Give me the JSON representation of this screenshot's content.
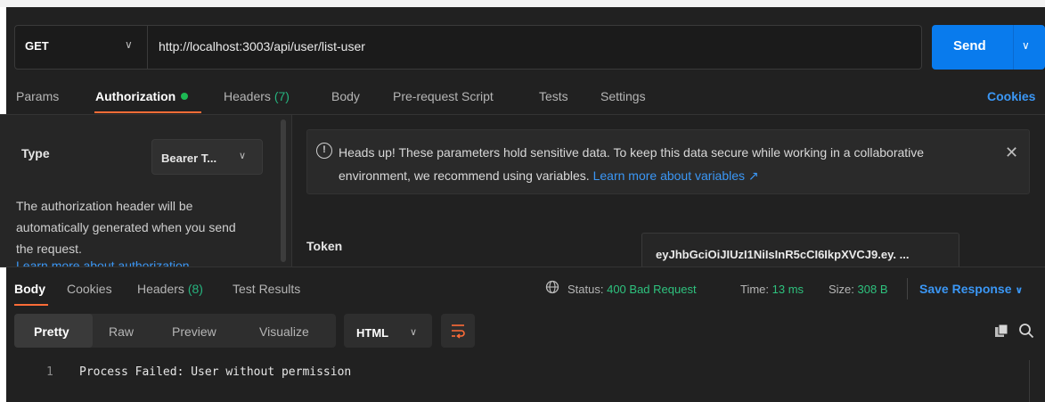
{
  "request": {
    "method": "GET",
    "url": "http://localhost:3003/api/user/list-user",
    "send_label": "Send"
  },
  "request_tabs": [
    {
      "label": "Params"
    },
    {
      "label": "Authorization"
    },
    {
      "label": "Headers",
      "count": "(7)"
    },
    {
      "label": "Body"
    },
    {
      "label": "Pre-request Script"
    },
    {
      "label": "Tests"
    },
    {
      "label": "Settings"
    }
  ],
  "cookies_link": "Cookies",
  "auth": {
    "type_label": "Type",
    "type_value": "Bearer T...",
    "description": "The authorization header will be automatically generated when you send the request.",
    "learn_more": "Learn more about authorization",
    "warning_text": "Heads up! These parameters hold sensitive data. To keep this data secure while working in a collaborative environment, we recommend using variables.",
    "warning_link": "Learn more about variables ↗",
    "token_label": "Token",
    "token_value": "eyJhbGciOiJIUzI1NiIsInR5cCI6IkpXVCJ9.ey. ..."
  },
  "response_tabs": [
    {
      "label": "Body"
    },
    {
      "label": "Cookies"
    },
    {
      "label": "Headers",
      "count": "(8)"
    },
    {
      "label": "Test Results"
    }
  ],
  "response_meta": {
    "status_label": "Status:",
    "status_value": "400 Bad Request",
    "time_label": "Time:",
    "time_value": "13 ms",
    "size_label": "Size:",
    "size_value": "308 B",
    "save_label": "Save Response"
  },
  "body_views": [
    "Pretty",
    "Raw",
    "Preview",
    "Visualize"
  ],
  "body_format": "HTML",
  "code_lines": [
    {
      "no": "1",
      "text": "Process Failed: User without permission"
    }
  ],
  "colors": {
    "accent_orange": "#ff6c37",
    "send_blue": "#097bed",
    "link_blue": "#3b97f5",
    "status_green": "#2ec27e"
  },
  "icons": [
    "chevron-down-icon",
    "info-icon",
    "close-icon",
    "globe-icon",
    "wrap-icon",
    "copy-icon",
    "search-icon"
  ]
}
